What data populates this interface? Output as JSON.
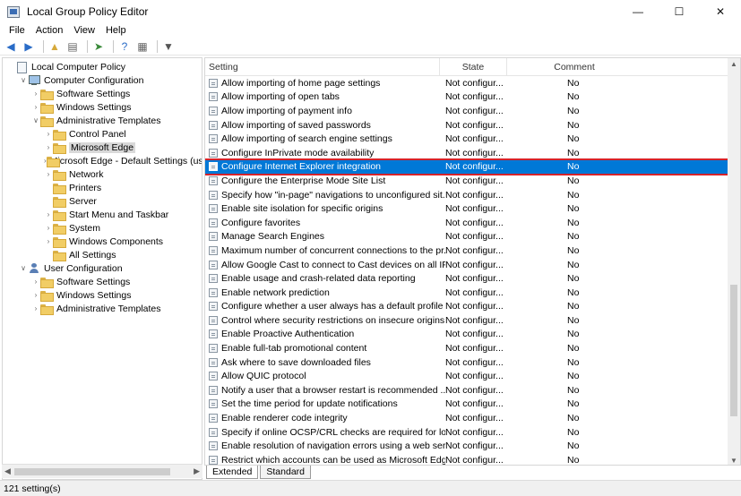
{
  "window": {
    "title": "Local Group Policy Editor",
    "minimize": "—",
    "maximize": "☐",
    "close": "✕"
  },
  "menu": [
    "File",
    "Action",
    "View",
    "Help"
  ],
  "tree": [
    {
      "label": "Local Computer Policy",
      "indent": 0,
      "expander": "",
      "icon": "document-icon"
    },
    {
      "label": "Computer Configuration",
      "indent": 1,
      "expander": "v",
      "icon": "computer-icon"
    },
    {
      "label": "Software Settings",
      "indent": 2,
      "expander": ">",
      "icon": "folder-icon"
    },
    {
      "label": "Windows Settings",
      "indent": 2,
      "expander": ">",
      "icon": "folder-icon"
    },
    {
      "label": "Administrative Templates",
      "indent": 2,
      "expander": "v",
      "icon": "folder-icon"
    },
    {
      "label": "Control Panel",
      "indent": 3,
      "expander": ">",
      "icon": "folder-icon"
    },
    {
      "label": "Microsoft Edge",
      "indent": 3,
      "expander": ">",
      "icon": "folder-icon",
      "selected": true
    },
    {
      "label": "Microsoft Edge - Default Settings (us",
      "indent": 3,
      "expander": ">",
      "icon": "folder-icon"
    },
    {
      "label": "Network",
      "indent": 3,
      "expander": ">",
      "icon": "folder-icon"
    },
    {
      "label": "Printers",
      "indent": 3,
      "expander": "",
      "icon": "folder-icon"
    },
    {
      "label": "Server",
      "indent": 3,
      "expander": "",
      "icon": "folder-icon"
    },
    {
      "label": "Start Menu and Taskbar",
      "indent": 3,
      "expander": ">",
      "icon": "folder-icon"
    },
    {
      "label": "System",
      "indent": 3,
      "expander": ">",
      "icon": "folder-icon"
    },
    {
      "label": "Windows Components",
      "indent": 3,
      "expander": ">",
      "icon": "folder-icon"
    },
    {
      "label": "All Settings",
      "indent": 3,
      "expander": "",
      "icon": "folder-icon"
    },
    {
      "label": "User Configuration",
      "indent": 1,
      "expander": "v",
      "icon": "user-icon"
    },
    {
      "label": "Software Settings",
      "indent": 2,
      "expander": ">",
      "icon": "folder-icon"
    },
    {
      "label": "Windows Settings",
      "indent": 2,
      "expander": ">",
      "icon": "folder-icon"
    },
    {
      "label": "Administrative Templates",
      "indent": 2,
      "expander": ">",
      "icon": "folder-icon"
    }
  ],
  "columns": {
    "setting": "Setting",
    "state": "State",
    "comment": "Comment"
  },
  "rows": [
    {
      "setting": "Allow importing of home page settings",
      "state": "Not configur...",
      "comment": "No"
    },
    {
      "setting": "Allow importing of open tabs",
      "state": "Not configur...",
      "comment": "No"
    },
    {
      "setting": "Allow importing of payment info",
      "state": "Not configur...",
      "comment": "No"
    },
    {
      "setting": "Allow importing of saved passwords",
      "state": "Not configur...",
      "comment": "No"
    },
    {
      "setting": "Allow importing of search engine settings",
      "state": "Not configur...",
      "comment": "No"
    },
    {
      "setting": "Configure InPrivate mode availability",
      "state": "Not configur...",
      "comment": "No"
    },
    {
      "setting": "Configure Internet Explorer integration",
      "state": "Not configur...",
      "comment": "No",
      "selected": true
    },
    {
      "setting": "Configure the Enterprise Mode Site List",
      "state": "Not configur...",
      "comment": "No"
    },
    {
      "setting": "Specify how \"in-page\" navigations to unconfigured sit...",
      "state": "Not configur...",
      "comment": "No"
    },
    {
      "setting": "Enable site isolation for specific origins",
      "state": "Not configur...",
      "comment": "No"
    },
    {
      "setting": "Configure favorites",
      "state": "Not configur...",
      "comment": "No"
    },
    {
      "setting": "Manage Search Engines",
      "state": "Not configur...",
      "comment": "No"
    },
    {
      "setting": "Maximum number of concurrent connections to the pr...",
      "state": "Not configur...",
      "comment": "No"
    },
    {
      "setting": "Allow Google Cast to connect to Cast devices on all IP...",
      "state": "Not configur...",
      "comment": "No"
    },
    {
      "setting": "Enable usage and crash-related data reporting",
      "state": "Not configur...",
      "comment": "No"
    },
    {
      "setting": "Enable network prediction",
      "state": "Not configur...",
      "comment": "No"
    },
    {
      "setting": "Configure whether a user always has a default profile ...",
      "state": "Not configur...",
      "comment": "No"
    },
    {
      "setting": "Control where security restrictions on insecure origins ...",
      "state": "Not configur...",
      "comment": "No"
    },
    {
      "setting": "Enable Proactive Authentication",
      "state": "Not configur...",
      "comment": "No"
    },
    {
      "setting": "Enable full-tab promotional content",
      "state": "Not configur...",
      "comment": "No"
    },
    {
      "setting": "Ask where to save downloaded files",
      "state": "Not configur...",
      "comment": "No"
    },
    {
      "setting": "Allow QUIC protocol",
      "state": "Not configur...",
      "comment": "No"
    },
    {
      "setting": "Notify a user that a browser restart is recommended ...",
      "state": "Not configur...",
      "comment": "No"
    },
    {
      "setting": "Set the time period for update notifications",
      "state": "Not configur...",
      "comment": "No"
    },
    {
      "setting": "Enable renderer code integrity",
      "state": "Not configur...",
      "comment": "No"
    },
    {
      "setting": "Specify if online OCSP/CRL checks are required for loc...",
      "state": "Not configur...",
      "comment": "No"
    },
    {
      "setting": "Enable resolution of navigation errors using a web ser...",
      "state": "Not configur...",
      "comment": "No"
    },
    {
      "setting": "Restrict which accounts can be used as Microsoft Edg...",
      "state": "Not configur...",
      "comment": "No"
    }
  ],
  "tabs": [
    "Extended",
    "Standard"
  ],
  "status": "121 setting(s)",
  "colors": {
    "selection": "#0078d7",
    "highlight_outline": "#d5232a"
  }
}
